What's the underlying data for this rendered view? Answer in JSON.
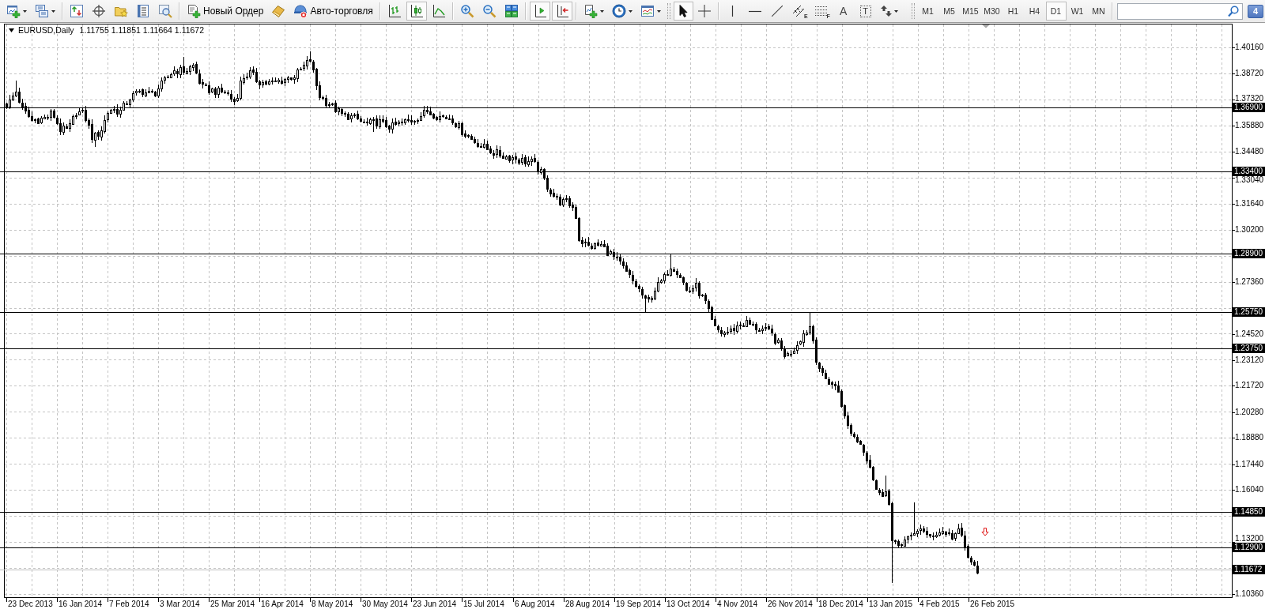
{
  "toolbar": {
    "new_order": "Новый Ордер",
    "auto_trading": "Авто-торговля",
    "chart_types": [
      {
        "kind": "bars",
        "selected": false
      },
      {
        "kind": "candles",
        "selected": true
      },
      {
        "kind": "line",
        "selected": false
      }
    ],
    "chart_shift": {
      "on": true
    },
    "auto_scroll": {
      "on": true
    },
    "pointer_tools": [
      {
        "kind": "cursor",
        "selected": true
      },
      {
        "kind": "crosshair",
        "selected": false
      }
    ],
    "object_tools": [
      {
        "kind": "vertical"
      },
      {
        "kind": "horizontal"
      },
      {
        "kind": "trendline"
      },
      {
        "kind": "channel",
        "mark": "E"
      },
      {
        "kind": "fibonacci",
        "mark": "F"
      },
      {
        "kind": "text",
        "mark": "A"
      },
      {
        "kind": "label",
        "mark": "T"
      },
      {
        "kind": "arrows"
      }
    ],
    "timeframes": [
      {
        "label": "M1",
        "selected": false
      },
      {
        "label": "M5",
        "selected": false
      },
      {
        "label": "M15",
        "selected": false
      },
      {
        "label": "M30",
        "selected": false
      },
      {
        "label": "H1",
        "selected": false
      },
      {
        "label": "H4",
        "selected": false
      },
      {
        "label": "D1",
        "selected": true
      },
      {
        "label": "W1",
        "selected": false
      },
      {
        "label": "MN",
        "selected": false
      }
    ],
    "notifications": "4"
  },
  "chart": {
    "symbol": "EURUSD,Daily",
    "ohlc": "1.11755 1.11851 1.11664 1.11672",
    "price_scale": [
      "1.40160",
      "1.38720",
      "1.37320",
      "1.35880",
      "1.34480",
      "1.33040",
      "1.31640",
      "1.30200",
      "1.27360",
      "1.24520",
      "1.23120",
      "1.21720",
      "1.20280",
      "1.18880",
      "1.17440",
      "1.16040",
      "1.13200",
      "1.10360"
    ],
    "levels": [
      "1.36900",
      "1.33400",
      "1.28900",
      "1.25750",
      "1.23750",
      "1.14850",
      "1.12900"
    ],
    "bid": "1.11672",
    "dates": [
      "23 Dec 2013",
      "16 Jan 2014",
      "7 Feb 2014",
      "3 Mar 2014",
      "25 Mar 2014",
      "16 Apr 2014",
      "8 May 2014",
      "30 May 2014",
      "23 Jun 2014",
      "15 Jul 2014",
      "6 Aug 2014",
      "28 Aug 2014",
      "19 Sep 2014",
      "13 Oct 2014",
      "4 Nov 2014",
      "26 Nov 2014",
      "18 Dec 2014",
      "13 Jan 2015",
      "4 Feb 2015",
      "26 Feb 2015"
    ]
  }
}
